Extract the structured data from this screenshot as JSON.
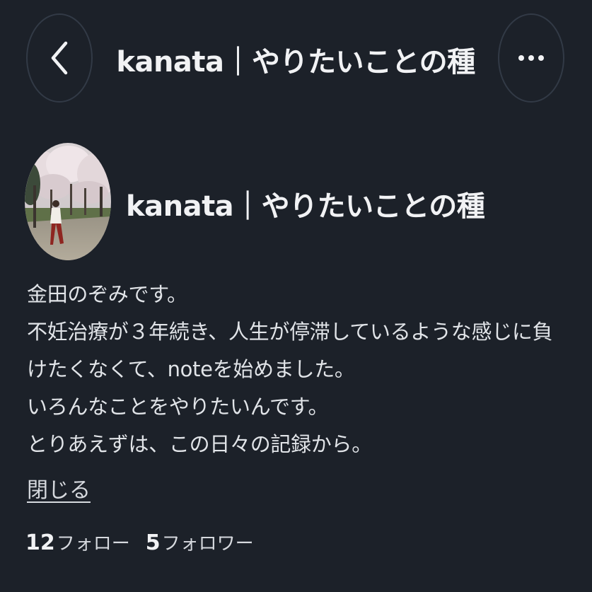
{
  "header": {
    "title": "kanata｜やりたいことの種",
    "back_icon": "chevron-left-icon",
    "more_icon": "more-horizontal-icon"
  },
  "profile": {
    "name": "kanata｜やりたいことの種",
    "bio": [
      "金田のぞみです。",
      "不妊治療が３年続き、人生が停滞しているような感じに負",
      "けたくなくて、noteを始めました。",
      "いろんなことをやりたいんです。",
      "とりあえずは、この日々の記録から。"
    ],
    "close_label": "閉じる"
  },
  "stats": {
    "following_count": "12",
    "following_label": "フォロー",
    "followers_count": "5",
    "followers_label": "フォロワー"
  },
  "colors": {
    "background": "#1c2129",
    "button_border": "#323a46",
    "text_primary": "#f1f2f4",
    "text_secondary": "#d6d9de"
  }
}
